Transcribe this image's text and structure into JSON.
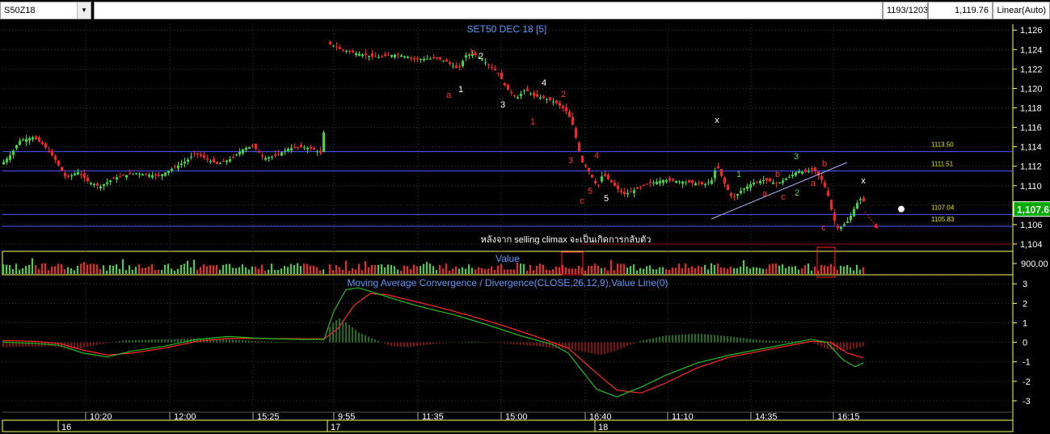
{
  "toolbar": {
    "symbol": "S50Z18",
    "bar_count": "1193/1203",
    "last_price": "1,119.76",
    "scale_mode": "Linear(Auto)"
  },
  "chart_data": [
    {
      "type": "candlestick",
      "title": "SET50 DEC 18   [5]",
      "y_ticks": [
        "1,126",
        "1,124",
        "1,122",
        "1,120",
        "1,118",
        "1,116",
        "1,114",
        "1,112",
        "1,110",
        "1,108",
        "1,106",
        "1,104"
      ],
      "y_range": [
        1103.5,
        1126.6
      ],
      "x_ticks": [
        "10:20",
        "12:00",
        "15:25",
        "9:55",
        "11:35",
        "15:00",
        "16:40",
        "11:10",
        "14:35",
        "16:15"
      ],
      "day_labels": [
        "16",
        "17",
        "18"
      ],
      "current_price_label": "1,107.6",
      "horizontal_lines": [
        {
          "value": 1113.5,
          "label": "1113.50"
        },
        {
          "value": 1111.51,
          "label": "1111.51"
        },
        {
          "value": 1107.04,
          "label": "1107.04"
        },
        {
          "value": 1105.83,
          "label": "1105.83"
        }
      ],
      "annotation": "หลังจาก selling climax จะเป็นเกิดการกลับตัว",
      "wave_labels": [
        {
          "text": "a",
          "color": "#ff3030"
        },
        {
          "text": "1",
          "color": "#ffffff"
        },
        {
          "text": "b",
          "color": "#ff3030"
        },
        {
          "text": "2",
          "color": "#ffffff"
        },
        {
          "text": "3",
          "color": "#ffffff"
        },
        {
          "text": "4",
          "color": "#ffffff"
        },
        {
          "text": "2",
          "color": "#ff3030"
        },
        {
          "text": "1",
          "color": "#ff3030"
        },
        {
          "text": "3",
          "color": "#ff3030"
        },
        {
          "text": "4",
          "color": "#ff3030"
        },
        {
          "text": "5",
          "color": "#ff3030"
        },
        {
          "text": "c",
          "color": "#ff3030"
        },
        {
          "text": "5",
          "color": "#ffffff"
        },
        {
          "text": "x",
          "color": "#ffffff"
        },
        {
          "text": "1",
          "color": "#55cc55"
        },
        {
          "text": "a",
          "color": "#ff3030"
        },
        {
          "text": "b",
          "color": "#ff3030"
        },
        {
          "text": "c",
          "color": "#ff3030"
        },
        {
          "text": "2",
          "color": "#55cc55"
        },
        {
          "text": "3",
          "color": "#55cc55"
        },
        {
          "text": "b",
          "color": "#ff3030"
        },
        {
          "text": "a",
          "color": "#ff3030"
        },
        {
          "text": "c",
          "color": "#ff3030"
        },
        {
          "text": "x",
          "color": "#ffffff"
        }
      ],
      "close_path": [
        [
          0,
          1112.2
        ],
        [
          12,
          1113.2
        ],
        [
          22,
          1114.6
        ],
        [
          40,
          1115.0
        ],
        [
          52,
          1114.2
        ],
        [
          66,
          1112.8
        ],
        [
          80,
          1110.8
        ],
        [
          95,
          1111.4
        ],
        [
          108,
          1110.4
        ],
        [
          122,
          1109.9
        ],
        [
          140,
          1110.8
        ],
        [
          165,
          1111.3
        ],
        [
          195,
          1111.0
        ],
        [
          215,
          1111.9
        ],
        [
          230,
          1112.6
        ],
        [
          240,
          1113.4
        ],
        [
          255,
          1112.7
        ],
        [
          268,
          1112.2
        ],
        [
          285,
          1112.8
        ],
        [
          300,
          1113.8
        ],
        [
          312,
          1114.1
        ],
        [
          325,
          1112.8
        ],
        [
          340,
          1113.1
        ],
        [
          355,
          1113.8
        ],
        [
          370,
          1114.0
        ],
        [
          385,
          1113.8
        ],
        [
          398,
          1113.2
        ],
        [
          403,
          1124.6
        ],
        [
          410,
          1124.5
        ],
        [
          420,
          1124.0
        ],
        [
          440,
          1123.6
        ],
        [
          465,
          1123.2
        ],
        [
          490,
          1123.5
        ],
        [
          515,
          1123.0
        ],
        [
          540,
          1123.1
        ],
        [
          550,
          1122.8
        ],
        [
          565,
          1122.0
        ],
        [
          575,
          1123.4
        ],
        [
          585,
          1123.6
        ],
        [
          600,
          1122.6
        ],
        [
          615,
          1121.6
        ],
        [
          625,
          1120.0
        ],
        [
          638,
          1119.0
        ],
        [
          648,
          1119.9
        ],
        [
          660,
          1119.2
        ],
        [
          672,
          1119.0
        ],
        [
          685,
          1118.6
        ],
        [
          698,
          1117.8
        ],
        [
          706,
          1116.6
        ],
        [
          712,
          1114.6
        ],
        [
          718,
          1112.5
        ],
        [
          724,
          1111.9
        ],
        [
          730,
          1111.0
        ],
        [
          738,
          1109.8
        ],
        [
          744,
          1111.2
        ],
        [
          752,
          1110.6
        ],
        [
          760,
          1109.9
        ],
        [
          770,
          1109.1
        ],
        [
          785,
          1109.6
        ],
        [
          800,
          1110.2
        ],
        [
          820,
          1110.6
        ],
        [
          845,
          1110.4
        ],
        [
          870,
          1110.1
        ],
        [
          880,
          1110.6
        ],
        [
          885,
          1112.2
        ],
        [
          895,
          1110.2
        ],
        [
          905,
          1108.6
        ],
        [
          915,
          1109.5
        ],
        [
          930,
          1110.3
        ],
        [
          945,
          1110.6
        ],
        [
          960,
          1110.2
        ],
        [
          975,
          1110.9
        ],
        [
          985,
          1111.5
        ],
        [
          995,
          1111.4
        ],
        [
          1005,
          1111.7
        ],
        [
          1015,
          1110.6
        ],
        [
          1022,
          1109.3
        ],
        [
          1028,
          1107.2
        ],
        [
          1034,
          1105.6
        ],
        [
          1040,
          1105.8
        ],
        [
          1048,
          1106.4
        ],
        [
          1055,
          1107.6
        ],
        [
          1062,
          1108.7
        ],
        [
          1068,
          1108.3
        ]
      ],
      "volume_label": "Value",
      "volume_tick": "900,00",
      "indicator_title": "Moving Average Convergence / Divergence(CLOSE,26,12,9),Value Line(0)",
      "macd_ticks": [
        "3",
        "2",
        "1",
        "0",
        "-1",
        "-2",
        "-3"
      ],
      "macd_range": [
        -3.5,
        3.3
      ],
      "macd_line": [
        [
          0,
          0.02
        ],
        [
          40,
          -0.05
        ],
        [
          70,
          -0.15
        ],
        [
          100,
          -0.55
        ],
        [
          130,
          -0.75
        ],
        [
          160,
          -0.45
        ],
        [
          200,
          -0.2
        ],
        [
          240,
          0.15
        ],
        [
          280,
          0.3
        ],
        [
          320,
          0.2
        ],
        [
          370,
          0.15
        ],
        [
          398,
          0.15
        ],
        [
          410,
          1.6
        ],
        [
          425,
          2.7
        ],
        [
          440,
          2.8
        ],
        [
          460,
          2.55
        ],
        [
          490,
          2.15
        ],
        [
          520,
          1.8
        ],
        [
          560,
          1.4
        ],
        [
          600,
          0.9
        ],
        [
          640,
          0.35
        ],
        [
          680,
          -0.1
        ],
        [
          700,
          -0.55
        ],
        [
          715,
          -1.35
        ],
        [
          735,
          -2.4
        ],
        [
          760,
          -2.8
        ],
        [
          790,
          -2.3
        ],
        [
          820,
          -1.7
        ],
        [
          860,
          -1.05
        ],
        [
          900,
          -0.65
        ],
        [
          950,
          -0.25
        ],
        [
          1000,
          0.15
        ],
        [
          1020,
          0.0
        ],
        [
          1040,
          -0.9
        ],
        [
          1055,
          -1.25
        ],
        [
          1065,
          -1.05
        ]
      ],
      "signal_line": [
        [
          0,
          0.1
        ],
        [
          40,
          0.05
        ],
        [
          70,
          -0.05
        ],
        [
          100,
          -0.4
        ],
        [
          130,
          -0.65
        ],
        [
          160,
          -0.55
        ],
        [
          200,
          -0.3
        ],
        [
          240,
          0.05
        ],
        [
          280,
          0.2
        ],
        [
          320,
          0.2
        ],
        [
          370,
          0.18
        ],
        [
          398,
          0.18
        ],
        [
          415,
          0.7
        ],
        [
          435,
          1.9
        ],
        [
          455,
          2.5
        ],
        [
          475,
          2.45
        ],
        [
          500,
          2.2
        ],
        [
          540,
          1.8
        ],
        [
          580,
          1.35
        ],
        [
          620,
          0.85
        ],
        [
          660,
          0.3
        ],
        [
          700,
          -0.3
        ],
        [
          730,
          -1.4
        ],
        [
          760,
          -2.45
        ],
        [
          790,
          -2.6
        ],
        [
          820,
          -2.1
        ],
        [
          860,
          -1.3
        ],
        [
          900,
          -0.75
        ],
        [
          950,
          -0.35
        ],
        [
          1000,
          0.05
        ],
        [
          1025,
          0.0
        ],
        [
          1045,
          -0.55
        ],
        [
          1065,
          -0.8
        ]
      ],
      "macd_hist": [
        [
          0,
          -0.25
        ],
        [
          60,
          -0.2
        ],
        [
          90,
          -0.35
        ],
        [
          120,
          -0.1
        ],
        [
          150,
          0.1
        ],
        [
          190,
          0.15
        ],
        [
          240,
          0.2
        ],
        [
          280,
          0.15
        ],
        [
          320,
          0.05
        ],
        [
          360,
          0.0
        ],
        [
          398,
          0.05
        ],
        [
          405,
          0.9
        ],
        [
          415,
          1.25
        ],
        [
          425,
          1.0
        ],
        [
          440,
          0.5
        ],
        [
          460,
          0.15
        ],
        [
          480,
          -0.2
        ],
        [
          500,
          -0.25
        ],
        [
          540,
          -0.05
        ],
        [
          580,
          0.05
        ],
        [
          620,
          -0.05
        ],
        [
          660,
          -0.2
        ],
        [
          700,
          -0.35
        ],
        [
          720,
          -0.5
        ],
        [
          740,
          -0.65
        ],
        [
          760,
          -0.4
        ],
        [
          790,
          0.1
        ],
        [
          820,
          0.35
        ],
        [
          860,
          0.45
        ],
        [
          900,
          0.3
        ],
        [
          940,
          0.1
        ],
        [
          980,
          0.05
        ],
        [
          1000,
          0.0
        ],
        [
          1020,
          -0.35
        ],
        [
          1040,
          -0.45
        ],
        [
          1065,
          -0.2
        ]
      ]
    }
  ],
  "colors": {
    "up": "#33dd33",
    "down": "#ff2020",
    "axis_frame": "#ffff66",
    "grid": "#3a3a3a",
    "title": "#5b9bff",
    "h_lines": "#4a5aff",
    "h_line_labels": "#e6e600"
  }
}
